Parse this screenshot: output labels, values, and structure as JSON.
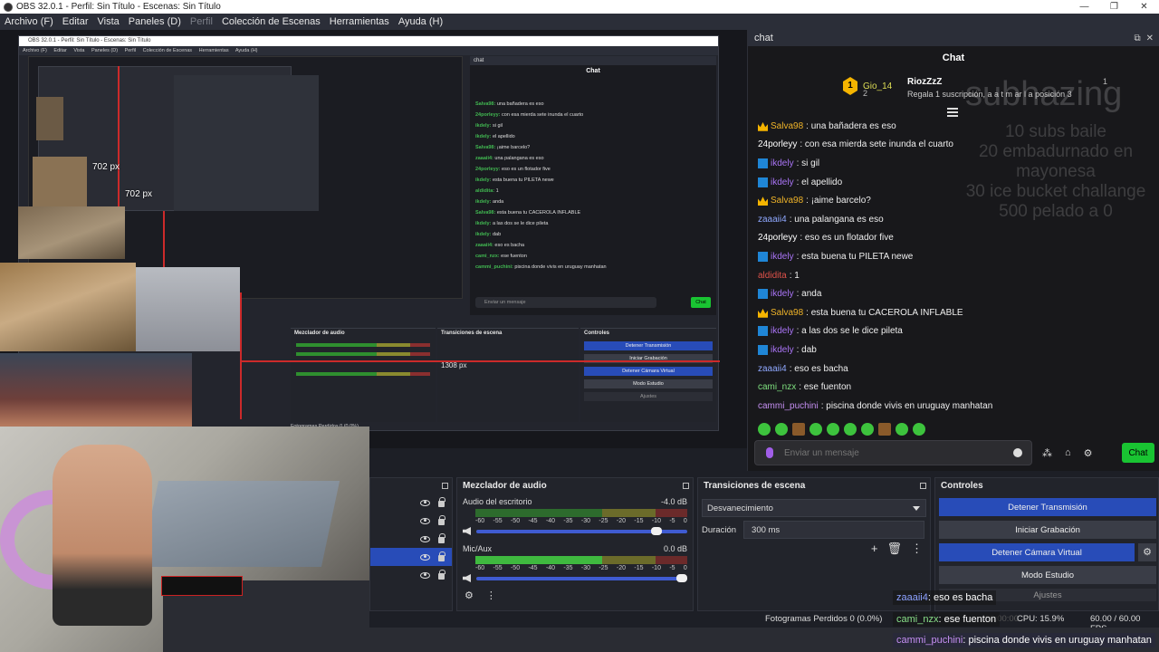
{
  "window": {
    "title": "OBS 32.0.1 - Perfil: Sin Título - Escenas: Sin Título",
    "controls": [
      "—",
      "❐",
      "✕"
    ]
  },
  "menu": [
    {
      "label": "Archivo (F)",
      "disabled": false
    },
    {
      "label": "Editar",
      "disabled": false
    },
    {
      "label": "Vista",
      "disabled": false
    },
    {
      "label": "Paneles (D)",
      "disabled": false
    },
    {
      "label": "Perfil",
      "disabled": true
    },
    {
      "label": "Colección de Escenas",
      "disabled": false
    },
    {
      "label": "Herramientas",
      "disabled": false
    },
    {
      "label": "Ayuda (H)",
      "disabled": false
    }
  ],
  "preview": {
    "labels": [
      "702 px",
      "702 px"
    ],
    "nested": {
      "title": "OBS 32.0.1 - Perfil: Sin Título - Escenas: Sin Título",
      "menu": [
        "Archivo (F)",
        "Editar",
        "Vista",
        "Paneles (D)",
        "Perfil",
        "Colección de Escenas",
        "Herramientas",
        "Ayuda (H)"
      ],
      "chat_header": "chat",
      "chat_title": "Chat",
      "chat_lines": [
        {
          "user": "Salva98:",
          "text": " una bañadera es eso"
        },
        {
          "user": "24porleyy:",
          "text": " con esa mierda sete inunda el cuarto"
        },
        {
          "user": "ikdely:",
          "text": " si gil"
        },
        {
          "user": "ikdely:",
          "text": " el apellido"
        },
        {
          "user": "Salva98:",
          "text": " ¡aime barcelo?"
        },
        {
          "user": "zaaaii4:",
          "text": " una palangana es eso"
        },
        {
          "user": "24porleyy:",
          "text": " eso es un flotador five"
        },
        {
          "user": "ikdely:",
          "text": " esta buena tu PILETA newe"
        },
        {
          "user": "aldidita:",
          "text": " 1"
        },
        {
          "user": "ikdely:",
          "text": " anda"
        },
        {
          "user": "Salva98:",
          "text": " esta buena tu CACEROLA INFLABLE"
        },
        {
          "user": "ikdely:",
          "text": " a las dos se le dice pileta"
        },
        {
          "user": "ikdely:",
          "text": " dab"
        },
        {
          "user": "zaaaii4:",
          "text": " eso es bacha"
        },
        {
          "user": "cami_nzx:",
          "text": " ese fuenton"
        },
        {
          "user": "cammi_puchini:",
          "text": " piscina donde vivis en uruguay manhatan"
        }
      ],
      "input_placeholder": "Enviar un mensaje",
      "chat_button": "Chat",
      "mixer_title": "Mezclador de audio",
      "trans_title": "Transiciones de escena",
      "controls_title": "Controles",
      "duration": "1308 px",
      "status": "Fotogramas Perdidos 0 (0.0%)",
      "buttons": [
        "Detener Transmisión",
        "Iniciar Grabación",
        "Detener Cámara Virtual",
        "Modo Estudio",
        "Ajustes"
      ]
    }
  },
  "chat": {
    "dock_title": "chat",
    "title": "Chat",
    "pinned": {
      "left_user": "Gio_14",
      "left_rank": "1",
      "left_count": "2",
      "right_user": "RiozZzZ",
      "right_count": "1",
      "right_subtitle": "Regala 1 suscripción, a a t m ar l a posición 3"
    },
    "ghost_text": "subhazing",
    "ghost_lines": [
      "10 subs baile",
      "20 embadurnado en mayonesa",
      "30 ice bucket challange",
      "500 pelado a 0"
    ],
    "messages": [
      {
        "badge": "crown",
        "user": "Salva98",
        "color": "#f0b429",
        "text": ": una bañadera es eso"
      },
      {
        "badge": "",
        "user": "24porleyy",
        "color": "#ffffff",
        "text": ": con esa mierda sete inunda el cuarto"
      },
      {
        "badge": "arrow",
        "user": "ikdely",
        "color": "#a974f5",
        "text": ": si gil"
      },
      {
        "badge": "arrow",
        "user": "ikdely",
        "color": "#a974f5",
        "text": ": el apellido"
      },
      {
        "badge": "crown",
        "user": "Salva98",
        "color": "#f0b429",
        "text": ": ¡aime barcelo?"
      },
      {
        "badge": "",
        "user": "zaaaii4",
        "color": "#8fa8ff",
        "text": ": una palangana es eso"
      },
      {
        "badge": "",
        "user": "24porleyy",
        "color": "#ffffff",
        "text": ": eso es un flotador five"
      },
      {
        "badge": "arrow",
        "user": "ikdely",
        "color": "#a974f5",
        "text": ": esta buena tu PILETA newe"
      },
      {
        "badge": "",
        "user": "aldidita",
        "color": "#e0524a",
        "text": ": 1"
      },
      {
        "badge": "arrow",
        "user": "ikdely",
        "color": "#a974f5",
        "text": ": anda"
      },
      {
        "badge": "crown",
        "user": "Salva98",
        "color": "#f0b429",
        "text": ": esta buena tu CACEROLA INFLABLE"
      },
      {
        "badge": "arrow",
        "user": "ikdely",
        "color": "#a974f5",
        "text": ": a las dos se le dice pileta"
      },
      {
        "badge": "arrow",
        "user": "ikdely",
        "color": "#a974f5",
        "text": ": dab"
      },
      {
        "badge": "",
        "user": "zaaaii4",
        "color": "#8fa8ff",
        "text": ": eso es bacha"
      },
      {
        "badge": "",
        "user": "cami_nzx",
        "color": "#7ee07e",
        "text": ": ese fuenton"
      },
      {
        "badge": "",
        "user": "cammi_puchini",
        "color": "#c58ff2",
        "text": ": piscina donde vivis en uruguay manhatan"
      }
    ],
    "input_placeholder": "Enviar un mensaje",
    "send_label": "Chat",
    "accent": "#19c432"
  },
  "docks": {
    "mixer": {
      "title": "Mezclador de audio",
      "channels": [
        {
          "name": "Audio del escritorio",
          "db": "-4.0 dB",
          "level": 0.88
        },
        {
          "name": "Mic/Aux",
          "db": "0.0 dB",
          "level": 1.0
        }
      ],
      "scale": [
        "-60",
        "-55",
        "-50",
        "-45",
        "-40",
        "-35",
        "-30",
        "-25",
        "-20",
        "-15",
        "-10",
        "-5",
        "0"
      ]
    },
    "transitions": {
      "title": "Transiciones de escena",
      "selected": "Desvanecimiento",
      "duration_label": "Duración",
      "duration_value": "300 ms"
    },
    "controls": {
      "title": "Controles",
      "stop_stream": "Detener Transmisión",
      "start_rec": "Iniciar Grabación",
      "stop_vcam": "Detener Cámara Virtual",
      "studio": "Modo Estudio",
      "settings": "Ajustes"
    }
  },
  "status": {
    "dropped": "Fotogramas Perdidos 0 (0.0%)",
    "time": "00:00:00",
    "cpu": "CPU: 15.9%",
    "fps": "60.00 / 60.00 FPS"
  },
  "overlay": [
    {
      "user": "zaaaii4",
      "text": ": eso es bacha"
    },
    {
      "user": "cami_nzx",
      "text": ": ese fuenton"
    },
    {
      "user": "cammi_puchini",
      "text": ": piscina donde vivis en uruguay manhatan"
    }
  ]
}
